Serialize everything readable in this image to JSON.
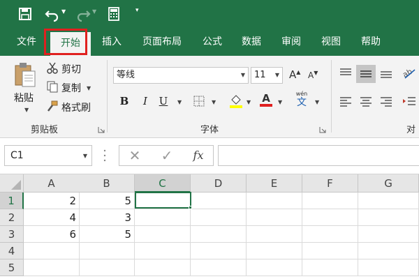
{
  "ribbon_tabs": [
    "文件",
    "开始",
    "插入",
    "页面布局",
    "公式",
    "数据",
    "审阅",
    "视图",
    "帮助"
  ],
  "clipboard": {
    "paste": "粘贴",
    "cut": "剪切",
    "copy": "复制",
    "format_painter": "格式刷",
    "group_label": "剪贴板"
  },
  "font": {
    "name": "等线",
    "size": "11",
    "group_label": "字体",
    "bold": "B",
    "italic": "I",
    "underline": "U",
    "font_color_glyph": "A",
    "phonetic": "wén",
    "phonetic_char": "文"
  },
  "alignment": {
    "group_label_partial": "对齐"
  },
  "formula_bar": {
    "name_box": "C1",
    "cancel": "✕",
    "enter": "✓",
    "fx": "fx",
    "value": ""
  },
  "grid": {
    "columns": [
      "A",
      "B",
      "C",
      "D",
      "E",
      "F",
      "G"
    ],
    "rows": [
      "1",
      "2",
      "3",
      "4",
      "5"
    ],
    "selected_cell": "C1",
    "cells": [
      [
        "2",
        "5",
        "",
        "",
        "",
        "",
        ""
      ],
      [
        "4",
        "3",
        "",
        "",
        "",
        "",
        ""
      ],
      [
        "6",
        "5",
        "",
        "",
        "",
        "",
        ""
      ],
      [
        "",
        "",
        "",
        "",
        "",
        "",
        ""
      ],
      [
        "",
        "",
        "",
        "",
        "",
        "",
        ""
      ]
    ]
  },
  "colors": {
    "theme_green": "#217346",
    "highlight_red": "#e0201f",
    "fill_yellow": "#ffff00",
    "font_red": "#e01f1f"
  }
}
